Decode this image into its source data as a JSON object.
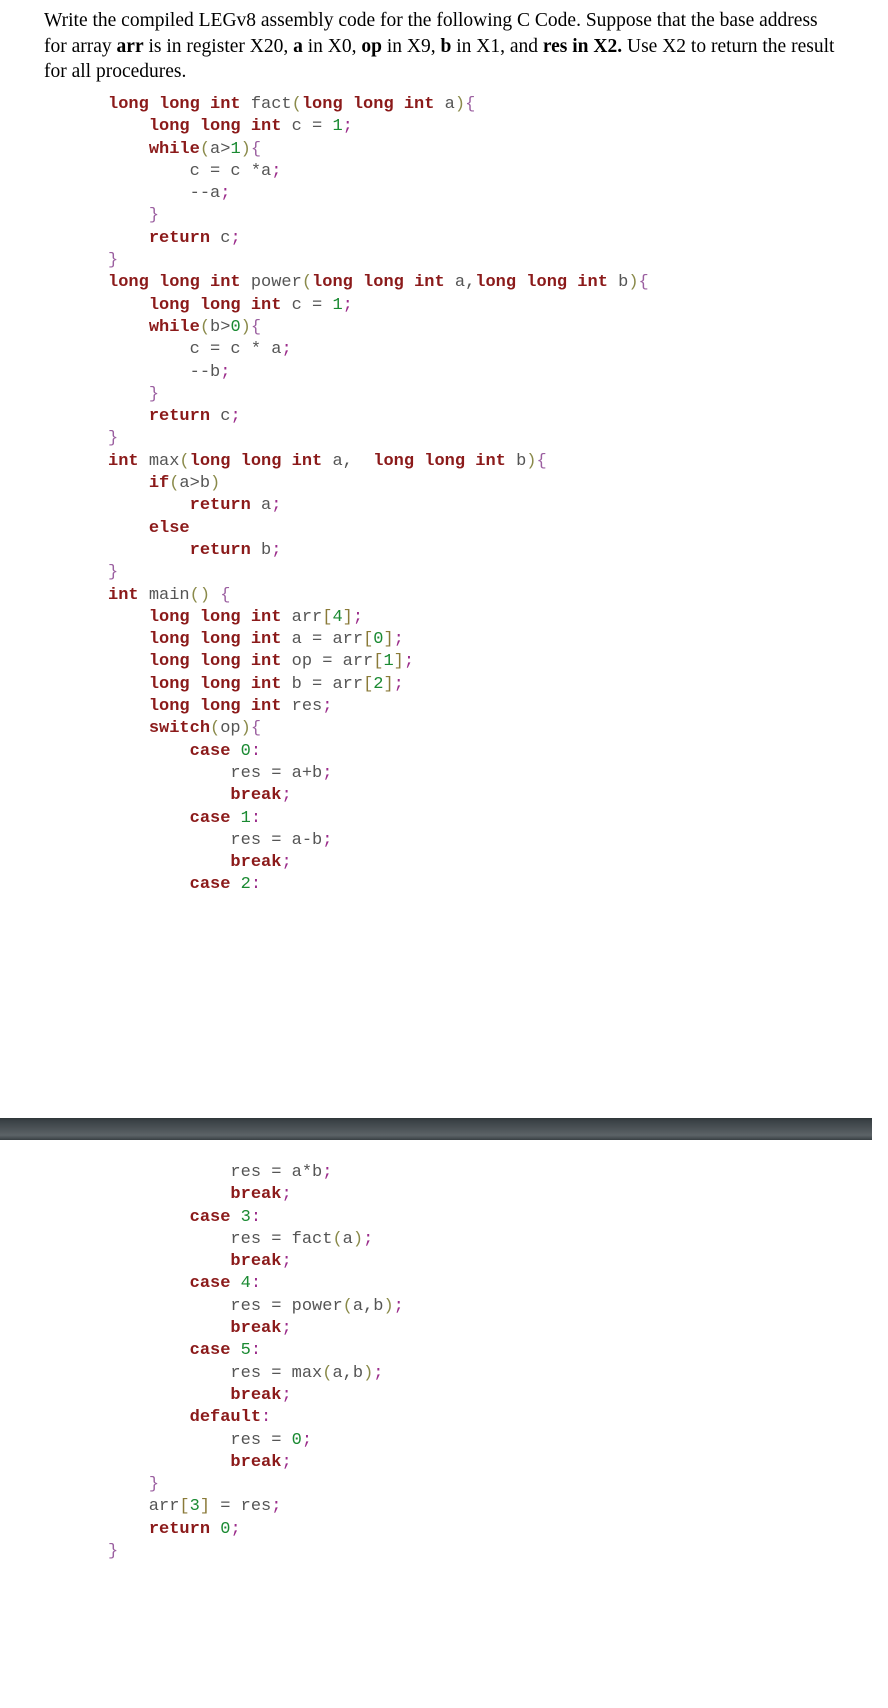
{
  "prompt": {
    "segments": [
      {
        "text": "Write the compiled LEGv8 assembly code for the following C Code. Suppose that the base address for array ",
        "bold": false
      },
      {
        "text": "arr",
        "bold": true
      },
      {
        "text": " is in register X20, ",
        "bold": false
      },
      {
        "text": "a",
        "bold": true
      },
      {
        "text": " in X0, ",
        "bold": false
      },
      {
        "text": "op",
        "bold": true
      },
      {
        "text": " in X9, ",
        "bold": false
      },
      {
        "text": "b",
        "bold": true
      },
      {
        "text": " in X1, and ",
        "bold": false
      },
      {
        "text": "res",
        "bold": true
      },
      {
        "text": " in X2.",
        "bold": true
      },
      {
        "text": " Use X2 to return the result for all procedures.",
        "bold": false
      }
    ],
    "plain_text": "Write the compiled LEGv8 assembly code for the following C Code. Suppose that the base address for array arr is in register X20, a in X0, op in X9, b in X1, and res in X2. Use X2 to return the result for all procedures."
  },
  "colors": {
    "keyword": "#8b1a1a",
    "identifier": "#555555",
    "number": "#1a8a32",
    "brace": "#9b5fa0",
    "paren": "#8a8a4a",
    "bracket": "#8a7a38",
    "semicolon": "#9b2d8b",
    "divider_bar": "#4c5357",
    "page_background": "#ffffff"
  },
  "code_top": {
    "language": "C",
    "plain_text": "long long int fact(long long int a){\n    long long int c = 1;\n    while(a>1){\n        c = c *a;\n        --a;\n    }\n    return c;\n}\nlong long int power(long long int a,long long int b){\n    long long int c = 1;\n    while(b>0){\n        c = c * a;\n        --b;\n    }\n    return c;\n}\nint max(long long int a,  long long int b){\n    if(a>b)\n        return a;\n    else\n        return b;\n}\nint main() {\n    long long int arr[4];\n    long long int a = arr[0];\n    long long int op = arr[1];\n    long long int b = arr[2];\n    long long int res;\n    switch(op){\n        case 0:\n            res = a+b;\n            break;\n        case 1:\n            res = a-b;\n            break;\n        case 2:",
    "lines": [
      [
        [
          "kw",
          "long long int "
        ],
        [
          "id",
          "fact"
        ],
        [
          "paren",
          "("
        ],
        [
          "kw",
          "long long int "
        ],
        [
          "id",
          "a"
        ],
        [
          "paren",
          ")"
        ],
        [
          "brace",
          "{"
        ]
      ],
      [
        [
          "id",
          "    "
        ],
        [
          "kw",
          "long long int "
        ],
        [
          "id",
          "c "
        ],
        [
          "op",
          "= "
        ],
        [
          "num",
          "1"
        ],
        [
          "semi",
          ";"
        ]
      ],
      [
        [
          "id",
          "    "
        ],
        [
          "kw",
          "while"
        ],
        [
          "paren",
          "("
        ],
        [
          "id",
          "a"
        ],
        [
          "op",
          ">"
        ],
        [
          "num",
          "1"
        ],
        [
          "paren",
          ")"
        ],
        [
          "brace",
          "{"
        ]
      ],
      [
        [
          "id",
          "        c = c *a"
        ],
        [
          "semi",
          ";"
        ]
      ],
      [
        [
          "id",
          "        --a"
        ],
        [
          "semi",
          ";"
        ]
      ],
      [
        [
          "id",
          "    "
        ],
        [
          "brace",
          "}"
        ]
      ],
      [
        [
          "id",
          "    "
        ],
        [
          "kw",
          "return "
        ],
        [
          "id",
          "c"
        ],
        [
          "semi",
          ";"
        ]
      ],
      [
        [
          "brace",
          "}"
        ]
      ],
      [
        [
          "kw",
          "long long int "
        ],
        [
          "id",
          "power"
        ],
        [
          "paren",
          "("
        ],
        [
          "kw",
          "long long int "
        ],
        [
          "id",
          "a"
        ],
        [
          "op",
          ","
        ],
        [
          "kw",
          "long long int "
        ],
        [
          "id",
          "b"
        ],
        [
          "paren",
          ")"
        ],
        [
          "brace",
          "{"
        ]
      ],
      [
        [
          "id",
          "    "
        ],
        [
          "kw",
          "long long int "
        ],
        [
          "id",
          "c "
        ],
        [
          "op",
          "= "
        ],
        [
          "num",
          "1"
        ],
        [
          "semi",
          ";"
        ]
      ],
      [
        [
          "id",
          "    "
        ],
        [
          "kw",
          "while"
        ],
        [
          "paren",
          "("
        ],
        [
          "id",
          "b"
        ],
        [
          "op",
          ">"
        ],
        [
          "num",
          "0"
        ],
        [
          "paren",
          ")"
        ],
        [
          "brace",
          "{"
        ]
      ],
      [
        [
          "id",
          "        c = c * a"
        ],
        [
          "semi",
          ";"
        ]
      ],
      [
        [
          "id",
          "        --b"
        ],
        [
          "semi",
          ";"
        ]
      ],
      [
        [
          "id",
          "    "
        ],
        [
          "brace",
          "}"
        ]
      ],
      [
        [
          "id",
          "    "
        ],
        [
          "kw",
          "return "
        ],
        [
          "id",
          "c"
        ],
        [
          "semi",
          ";"
        ]
      ],
      [
        [
          "brace",
          "}"
        ]
      ],
      [
        [
          "kw",
          "int "
        ],
        [
          "id",
          "max"
        ],
        [
          "paren",
          "("
        ],
        [
          "kw",
          "long long int "
        ],
        [
          "id",
          "a"
        ],
        [
          "op",
          ",  "
        ],
        [
          "kw",
          "long long int "
        ],
        [
          "id",
          "b"
        ],
        [
          "paren",
          ")"
        ],
        [
          "brace",
          "{"
        ]
      ],
      [
        [
          "id",
          "    "
        ],
        [
          "kw",
          "if"
        ],
        [
          "paren",
          "("
        ],
        [
          "id",
          "a"
        ],
        [
          "op",
          ">"
        ],
        [
          "id",
          "b"
        ],
        [
          "paren",
          ")"
        ]
      ],
      [
        [
          "id",
          "        "
        ],
        [
          "kw",
          "return "
        ],
        [
          "id",
          "a"
        ],
        [
          "semi",
          ";"
        ]
      ],
      [
        [
          "id",
          "    "
        ],
        [
          "kw",
          "else"
        ]
      ],
      [
        [
          "id",
          "        "
        ],
        [
          "kw",
          "return "
        ],
        [
          "id",
          "b"
        ],
        [
          "semi",
          ";"
        ]
      ],
      [
        [
          "brace",
          "}"
        ]
      ],
      [
        [
          "kw",
          "int "
        ],
        [
          "id",
          "main"
        ],
        [
          "paren",
          "()"
        ],
        [
          "id",
          " "
        ],
        [
          "brace",
          "{"
        ]
      ],
      [
        [
          "id",
          "    "
        ],
        [
          "kw",
          "long long int "
        ],
        [
          "id",
          "arr"
        ],
        [
          "brkt",
          "["
        ],
        [
          "num",
          "4"
        ],
        [
          "brkt",
          "]"
        ],
        [
          "semi",
          ";"
        ]
      ],
      [
        [
          "id",
          "    "
        ],
        [
          "kw",
          "long long int "
        ],
        [
          "id",
          "a "
        ],
        [
          "op",
          "= "
        ],
        [
          "id",
          "arr"
        ],
        [
          "brkt",
          "["
        ],
        [
          "num",
          "0"
        ],
        [
          "brkt",
          "]"
        ],
        [
          "semi",
          ";"
        ]
      ],
      [
        [
          "id",
          "    "
        ],
        [
          "kw",
          "long long int "
        ],
        [
          "id",
          "op "
        ],
        [
          "op",
          "= "
        ],
        [
          "id",
          "arr"
        ],
        [
          "brkt",
          "["
        ],
        [
          "num",
          "1"
        ],
        [
          "brkt",
          "]"
        ],
        [
          "semi",
          ";"
        ]
      ],
      [
        [
          "id",
          "    "
        ],
        [
          "kw",
          "long long int "
        ],
        [
          "id",
          "b "
        ],
        [
          "op",
          "= "
        ],
        [
          "id",
          "arr"
        ],
        [
          "brkt",
          "["
        ],
        [
          "num",
          "2"
        ],
        [
          "brkt",
          "]"
        ],
        [
          "semi",
          ";"
        ]
      ],
      [
        [
          "id",
          "    "
        ],
        [
          "kw",
          "long long int "
        ],
        [
          "id",
          "res"
        ],
        [
          "semi",
          ";"
        ]
      ],
      [
        [
          "id",
          "    "
        ],
        [
          "kw",
          "switch"
        ],
        [
          "paren",
          "("
        ],
        [
          "id",
          "op"
        ],
        [
          "paren",
          ")"
        ],
        [
          "brace",
          "{"
        ]
      ],
      [
        [
          "id",
          "        "
        ],
        [
          "kw",
          "case "
        ],
        [
          "num",
          "0"
        ],
        [
          "semi",
          ":"
        ]
      ],
      [
        [
          "id",
          "            res = a+b"
        ],
        [
          "semi",
          ";"
        ]
      ],
      [
        [
          "id",
          "            "
        ],
        [
          "kw",
          "break"
        ],
        [
          "semi",
          ";"
        ]
      ],
      [
        [
          "id",
          "        "
        ],
        [
          "kw",
          "case "
        ],
        [
          "num",
          "1"
        ],
        [
          "semi",
          ":"
        ]
      ],
      [
        [
          "id",
          "            res = a-b"
        ],
        [
          "semi",
          ";"
        ]
      ],
      [
        [
          "id",
          "            "
        ],
        [
          "kw",
          "break"
        ],
        [
          "semi",
          ";"
        ]
      ],
      [
        [
          "id",
          "        "
        ],
        [
          "kw",
          "case "
        ],
        [
          "num",
          "2"
        ],
        [
          "semi",
          ":"
        ]
      ]
    ]
  },
  "code_bottom": {
    "language": "C",
    "plain_text": "            res = a*b;\n            break;\n        case 3:\n            res = fact(a);\n            break;\n        case 4:\n            res = power(a,b);\n            break;\n        case 5:\n            res = max(a,b);\n            break;\n        default:\n            res = 0;\n            break;\n    }\n    arr[3] = res;\n    return 0;\n}",
    "lines": [
      [
        [
          "id",
          "            res = a*b"
        ],
        [
          "semi",
          ";"
        ]
      ],
      [
        [
          "id",
          "            "
        ],
        [
          "kw",
          "break"
        ],
        [
          "semi",
          ";"
        ]
      ],
      [
        [
          "id",
          "        "
        ],
        [
          "kw",
          "case "
        ],
        [
          "num",
          "3"
        ],
        [
          "semi",
          ":"
        ]
      ],
      [
        [
          "id",
          "            res = "
        ],
        [
          "id",
          "fact"
        ],
        [
          "paren",
          "("
        ],
        [
          "id",
          "a"
        ],
        [
          "paren",
          ")"
        ],
        [
          "semi",
          ";"
        ]
      ],
      [
        [
          "id",
          "            "
        ],
        [
          "kw",
          "break"
        ],
        [
          "semi",
          ";"
        ]
      ],
      [
        [
          "id",
          "        "
        ],
        [
          "kw",
          "case "
        ],
        [
          "num",
          "4"
        ],
        [
          "semi",
          ":"
        ]
      ],
      [
        [
          "id",
          "            res = "
        ],
        [
          "id",
          "power"
        ],
        [
          "paren",
          "("
        ],
        [
          "id",
          "a"
        ],
        [
          "op",
          ","
        ],
        [
          "id",
          "b"
        ],
        [
          "paren",
          ")"
        ],
        [
          "semi",
          ";"
        ]
      ],
      [
        [
          "id",
          "            "
        ],
        [
          "kw",
          "break"
        ],
        [
          "semi",
          ";"
        ]
      ],
      [
        [
          "id",
          "        "
        ],
        [
          "kw",
          "case "
        ],
        [
          "num",
          "5"
        ],
        [
          "semi",
          ":"
        ]
      ],
      [
        [
          "id",
          "            res = "
        ],
        [
          "id",
          "max"
        ],
        [
          "paren",
          "("
        ],
        [
          "id",
          "a"
        ],
        [
          "op",
          ","
        ],
        [
          "id",
          "b"
        ],
        [
          "paren",
          ")"
        ],
        [
          "semi",
          ";"
        ]
      ],
      [
        [
          "id",
          "            "
        ],
        [
          "kw",
          "break"
        ],
        [
          "semi",
          ";"
        ]
      ],
      [
        [
          "id",
          "        "
        ],
        [
          "kw",
          "default"
        ],
        [
          "semi",
          ":"
        ]
      ],
      [
        [
          "id",
          "            res = "
        ],
        [
          "num",
          "0"
        ],
        [
          "semi",
          ";"
        ]
      ],
      [
        [
          "id",
          "            "
        ],
        [
          "kw",
          "break"
        ],
        [
          "semi",
          ";"
        ]
      ],
      [
        [
          "id",
          "    "
        ],
        [
          "brace",
          "}"
        ]
      ],
      [
        [
          "id",
          "    arr"
        ],
        [
          "brkt",
          "["
        ],
        [
          "num",
          "3"
        ],
        [
          "brkt",
          "]"
        ],
        [
          "id",
          " = res"
        ],
        [
          "semi",
          ";"
        ]
      ],
      [
        [
          "id",
          "    "
        ],
        [
          "kw",
          "return "
        ],
        [
          "num",
          "0"
        ],
        [
          "semi",
          ";"
        ]
      ],
      [
        [
          "brace",
          "}"
        ]
      ]
    ]
  },
  "divider": {
    "label": "page-break-bar"
  }
}
